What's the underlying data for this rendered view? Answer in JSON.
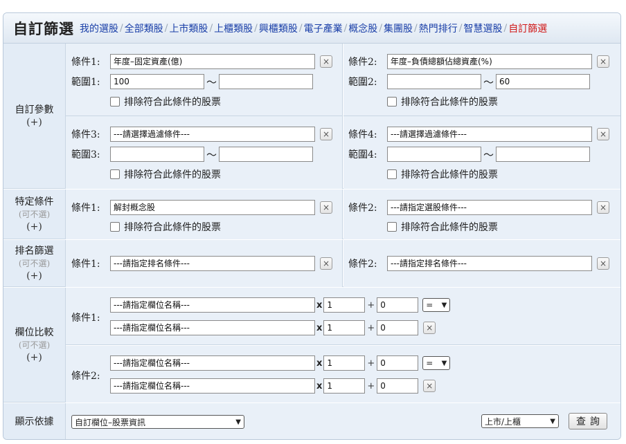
{
  "header": {
    "title": "自訂篩選",
    "nav": [
      "我的選股",
      "全部類股",
      "上市類股",
      "上櫃類股",
      "興櫃類股",
      "電子產業",
      "概念股",
      "集團股",
      "熱門排行",
      "智慧選股",
      "自訂篩選"
    ],
    "active_index": 10
  },
  "custom_params": {
    "label": "自訂參數",
    "plus": "(+)",
    "cond1": {
      "label": "條件1:",
      "value": "年度–固定資產(億)",
      "range_label": "範圍1:",
      "min": "100",
      "max": "",
      "exclude": "排除符合此條件的股票"
    },
    "cond2": {
      "label": "條件2:",
      "value": "年度–負債總額佔總資產(%)",
      "range_label": "範圍2:",
      "min": "",
      "max": "60",
      "exclude": "排除符合此條件的股票"
    },
    "cond3": {
      "label": "條件3:",
      "value": "---請選擇過濾條件---",
      "range_label": "範圍3:",
      "min": "",
      "max": "",
      "exclude": "排除符合此條件的股票"
    },
    "cond4": {
      "label": "條件4:",
      "value": "---請選擇過濾條件---",
      "range_label": "範圍4:",
      "min": "",
      "max": "",
      "exclude": "排除符合此條件的股票"
    },
    "tilde": "～",
    "clear": "×"
  },
  "special": {
    "label": "特定條件",
    "optional": "(可不選)",
    "plus": "(+)",
    "cond1": {
      "label": "條件1:",
      "value": "解封概念股",
      "exclude": "排除符合此條件的股票"
    },
    "cond2": {
      "label": "條件2:",
      "value": "---請指定選股條件---",
      "exclude": "排除符合此條件的股票"
    }
  },
  "ranking": {
    "label": "排名篩選",
    "optional": "(可不選)",
    "plus": "(+)",
    "cond1": {
      "label": "條件1:",
      "value": "---請指定排名條件---"
    },
    "cond2": {
      "label": "條件2:",
      "value": "---請指定排名條件---"
    }
  },
  "compare": {
    "label": "欄位比較",
    "optional": "(可不選)",
    "plus": "(+)",
    "times": "x",
    "add": "+",
    "cond1": {
      "label": "條件1:",
      "field_a": "---請指定欄位名稱---",
      "mult_a": "1",
      "add_a": "0",
      "operator": "=",
      "field_b": "---請指定欄位名稱---",
      "mult_b": "1",
      "add_b": "0"
    },
    "cond2": {
      "label": "條件2:",
      "field_a": "---請指定欄位名稱---",
      "mult_a": "1",
      "add_a": "0",
      "operator": "=",
      "field_b": "---請指定欄位名稱---",
      "mult_b": "1",
      "add_b": "0"
    }
  },
  "display": {
    "label": "顯示依據",
    "basis": "自訂欄位–股票資訊",
    "market": "上市/上櫃",
    "query_button": "查詢"
  }
}
